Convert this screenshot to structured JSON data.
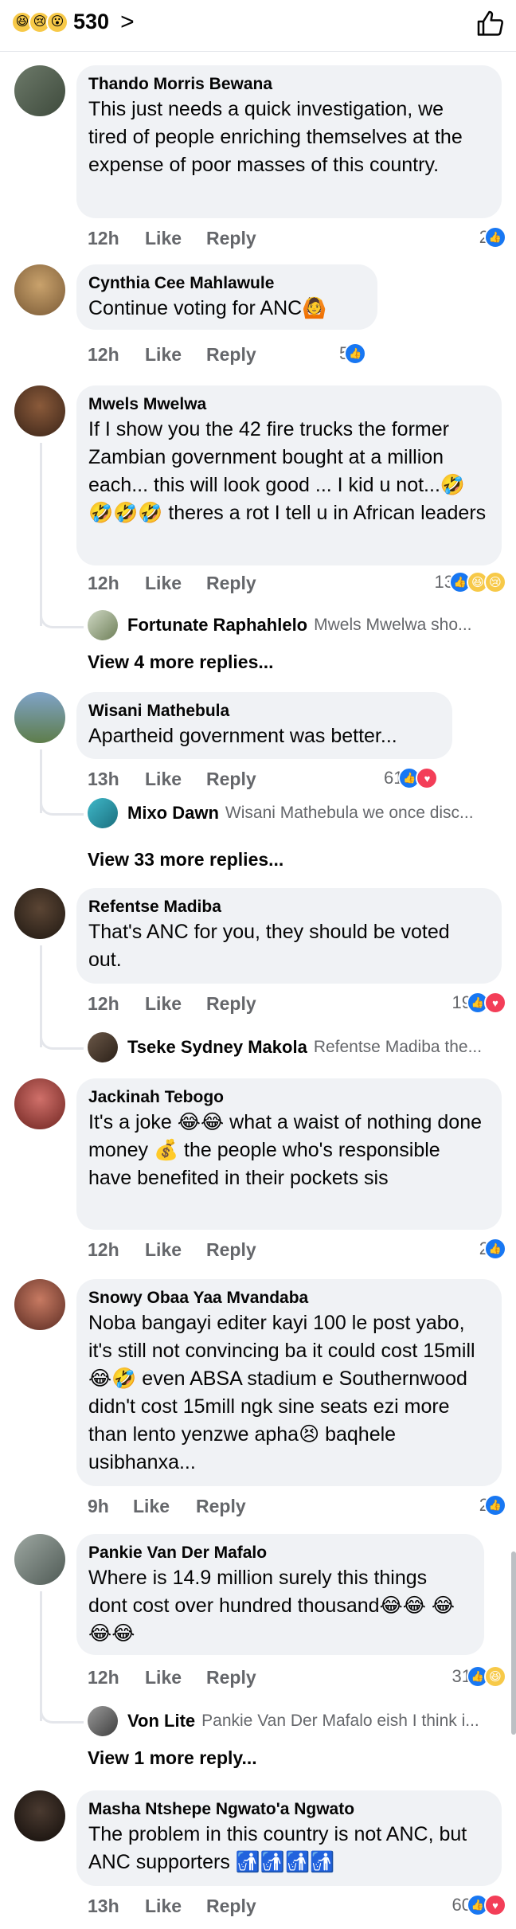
{
  "header": {
    "reaction_icons": [
      "grinning-squinting-tears",
      "sad",
      "wow"
    ],
    "reaction_count": "530",
    "chevron": ">"
  },
  "comments": [
    {
      "author": "Thando Morris Bewana",
      "text": "This just needs a quick investigation, we tired of people enriching themselves at the expense of poor masses of this country.",
      "time": "12h",
      "like": "Like",
      "reply": "Reply",
      "reactions": "2"
    },
    {
      "author": "Cynthia Cee Mahlawule",
      "text": "Continue voting for ANC🙆",
      "time": "12h",
      "like": "Like",
      "reply": "Reply",
      "reactions": "5"
    },
    {
      "author": "Mwels Mwelwa",
      "text": "If I show you the 42 fire trucks the former Zambian government bought at a million each... this will look good ... I kid u not...🤣🤣🤣🤣 theres a rot I tell u in African leaders",
      "time": "12h",
      "like": "Like",
      "reply": "Reply",
      "reactions": "13",
      "reply_preview": {
        "name": "Fortunate Raphahlelo",
        "text": "Mwels Mwelwa sho..."
      },
      "more_replies": "View 4 more replies..."
    },
    {
      "author": "Wisani Mathebula",
      "text": "Apartheid government was better...",
      "time": "13h",
      "like": "Like",
      "reply": "Reply",
      "reactions": "61",
      "reply_preview": {
        "name": "Mixo Dawn",
        "text": "Wisani Mathebula we once disc..."
      },
      "more_replies": "View 33 more replies..."
    },
    {
      "author": "Refentse Madiba",
      "text": "That's ANC for you, they should be voted out.",
      "time": "12h",
      "like": "Like",
      "reply": "Reply",
      "reactions": "19",
      "reply_preview": {
        "name": "Tseke Sydney Makola",
        "text": "Refentse Madiba the..."
      }
    },
    {
      "author": "Jackinah Tebogo",
      "text": "It's a joke 😂😂 what a waist of nothing done money 💰 the people who's responsible have benefited in their pockets sis",
      "time": "12h",
      "like": "Like",
      "reply": "Reply",
      "reactions": "2"
    },
    {
      "author": "Snowy Obaa Yaa Mvandaba",
      "text": "Noba bangayi editer kayi 100 le post yabo, it's still not convincing ba it could cost 15mill 😂🤣 even ABSA stadium e Southernwood didn't cost 15mill ngk sine seats ezi more than lento yenzwe apha😣 baqhele usibhanxa...",
      "time": "9h",
      "like": "Like",
      "reply": "Reply",
      "reactions": "2"
    },
    {
      "author": "Pankie Van Der Mafalo",
      "text": "Where is 14.9 million  surely this things dont cost over hundred thousand😂😂 😂😂😂",
      "time": "12h",
      "like": "Like",
      "reply": "Reply",
      "reactions": "31",
      "reply_preview": {
        "name": "Von Lite",
        "text": "Pankie Van Der Mafalo eish I think i..."
      },
      "more_replies": "View 1 more reply..."
    },
    {
      "author": "Masha Ntshepe Ngwato'a Ngwato",
      "text": "The problem in this country is not ANC, but ANC supporters 🚮🚮🚮🚮",
      "time": "13h",
      "like": "Like",
      "reply": "Reply",
      "reactions": "60"
    }
  ],
  "colors": {
    "bubble": "#f0f2f5",
    "meta": "#65676b",
    "like": "#1877f2",
    "love": "#f33e58"
  }
}
